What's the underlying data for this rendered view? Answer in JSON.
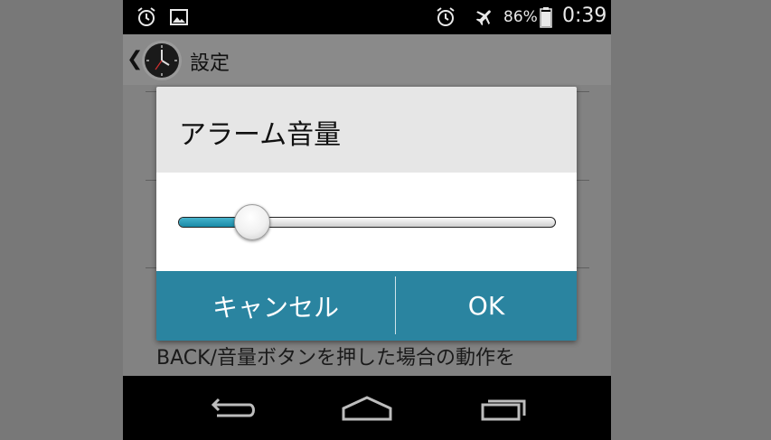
{
  "status_bar": {
    "icons": [
      "alarm-icon",
      "image-notification-icon",
      "alarm-icon",
      "airplane-mode-icon",
      "battery-icon"
    ],
    "battery_percent": "86%",
    "time": "0:39"
  },
  "action_bar": {
    "back_glyph": "❮",
    "app_icon": "clock-icon",
    "title": "設定"
  },
  "background": {
    "description_text": "BACK/音量ボタンを押した場合の動作を"
  },
  "dialog": {
    "title": "アラーム音量",
    "volume_level": 0.15,
    "accent_color": "#2a84a0",
    "fill_color": "#1a8aa6",
    "cancel_label": "キャンセル",
    "ok_label": "OK"
  },
  "nav_bar": {
    "buttons": [
      "back-icon",
      "home-icon",
      "recent-apps-icon"
    ]
  }
}
